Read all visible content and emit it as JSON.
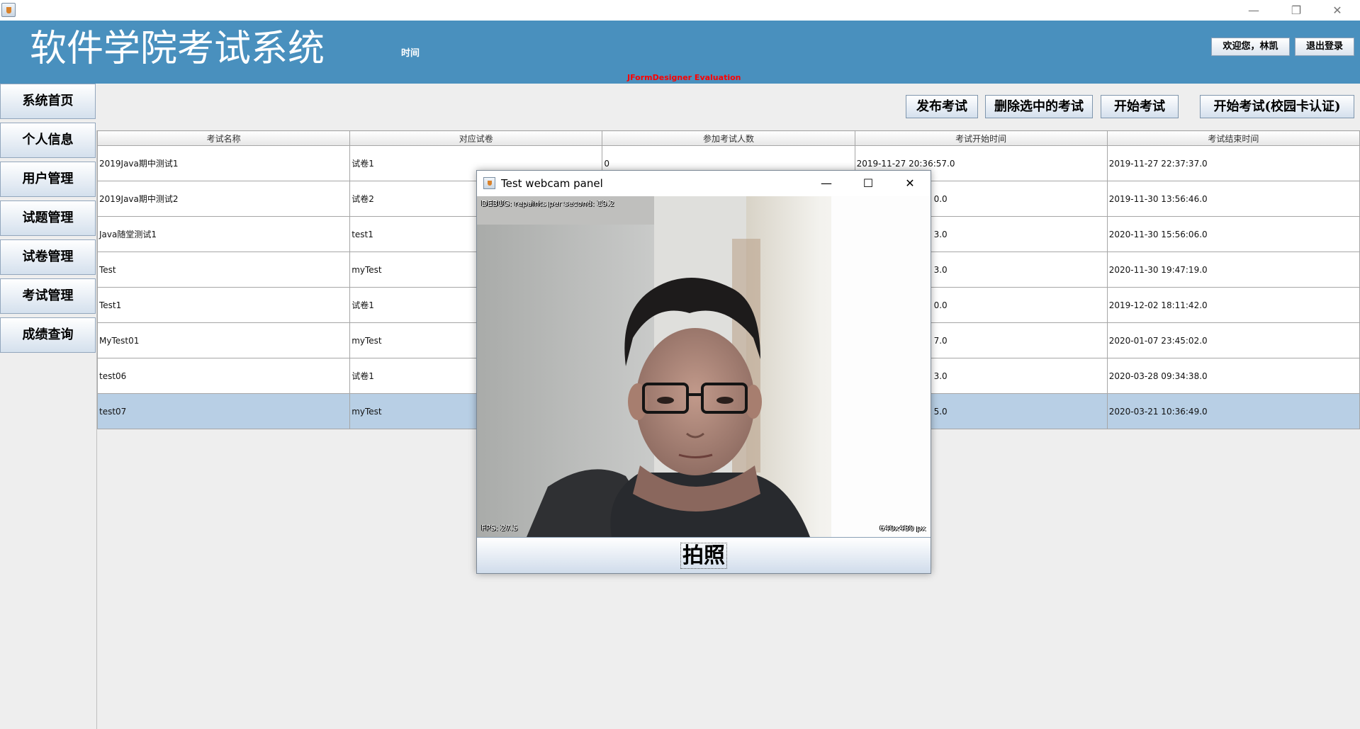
{
  "window": {
    "minimize": "—",
    "restore": "❐",
    "close": "✕"
  },
  "header": {
    "title": "软件学院考试系统",
    "time_label": "时间",
    "welcome_button": "欢迎您，林凯",
    "logout_button": "退出登录",
    "evaluation_notice": "JFormDesigner Evaluation"
  },
  "sidebar": {
    "items": [
      {
        "label": "系统首页"
      },
      {
        "label": "个人信息"
      },
      {
        "label": "用户管理"
      },
      {
        "label": "试题管理"
      },
      {
        "label": "试卷管理"
      },
      {
        "label": "考试管理"
      },
      {
        "label": "成绩查询"
      }
    ]
  },
  "actions": {
    "publish": "发布考试",
    "delete_selected": "删除选中的考试",
    "start": "开始考试",
    "start_card": "开始考试(校园卡认证)"
  },
  "table": {
    "headers": [
      "考试名称",
      "对应试卷",
      "参加考试人数",
      "考试开始时间",
      "考试结束时间"
    ],
    "rows": [
      [
        "2019Java期中测试1",
        "试卷1",
        "0",
        "2019-11-27 20:36:57.0",
        "2019-11-27 22:37:37.0"
      ],
      [
        "2019Java期中测试2",
        "试卷2",
        "",
        "0.0",
        "2019-11-30 13:56:46.0"
      ],
      [
        "Java随堂测试1",
        "test1",
        "",
        "3.0",
        "2020-11-30 15:56:06.0"
      ],
      [
        "Test",
        "myTest",
        "",
        "3.0",
        "2020-11-30 19:47:19.0"
      ],
      [
        "Test1",
        "试卷1",
        "",
        "0.0",
        "2019-12-02 18:11:42.0"
      ],
      [
        "MyTest01",
        "myTest",
        "",
        "7.0",
        "2020-01-07 23:45:02.0"
      ],
      [
        "test06",
        "试卷1",
        "",
        "3.0",
        "2020-03-28 09:34:38.0"
      ],
      [
        "test07",
        "myTest",
        "",
        "5.0",
        "2020-03-21 10:36:49.0"
      ]
    ],
    "selected_row": 7
  },
  "dialog": {
    "title": "Test webcam panel",
    "minimize": "—",
    "maximize": "☐",
    "close": "✕",
    "debug_text": "DEBUG: repaints per second: 19.2",
    "fps_text": "FPS: 27.5",
    "resolution_text": "640x480 px",
    "snap_button": "拍照"
  }
}
